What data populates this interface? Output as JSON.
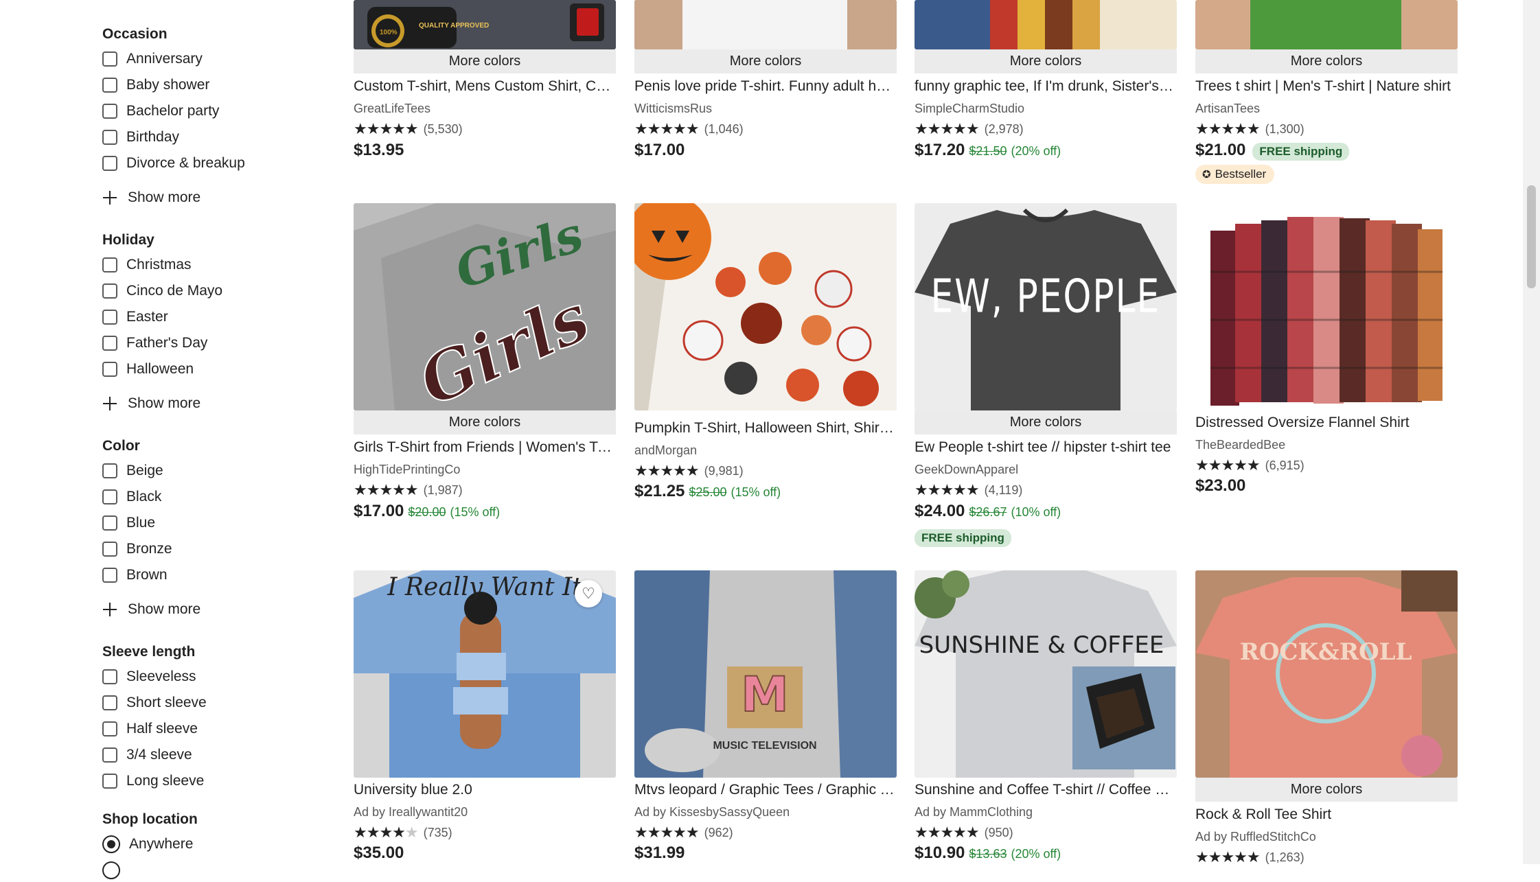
{
  "sidebar": {
    "occasion": {
      "title": "Occasion",
      "options": [
        "Anniversary",
        "Baby shower",
        "Bachelor party",
        "Birthday",
        "Divorce & breakup"
      ],
      "show_more": "Show more"
    },
    "holiday": {
      "title": "Holiday",
      "options": [
        "Christmas",
        "Cinco de Mayo",
        "Easter",
        "Father's Day",
        "Halloween"
      ],
      "show_more": "Show more"
    },
    "color": {
      "title": "Color",
      "options": [
        "Beige",
        "Black",
        "Blue",
        "Bronze",
        "Brown"
      ],
      "show_more": "Show more"
    },
    "sleeve_length": {
      "title": "Sleeve length",
      "options": [
        "Sleeveless",
        "Short sleeve",
        "Half sleeve",
        "3/4 sleeve",
        "Long sleeve"
      ]
    },
    "shop_location": {
      "title": "Shop location",
      "selected": "Anywhere"
    }
  },
  "listings": [
    {
      "more_colors": "More colors",
      "title": "Custom T-shirt, Mens Custom Shirt, Custom Printed T-shirt",
      "shop": "GreatLifeTees",
      "stars": "★★★★★",
      "count": "(5,530)",
      "price": "$13.95",
      "image_text": "QUALITY APPROVED"
    },
    {
      "more_colors": "More colors",
      "title": "Penis love pride T-shirt. Funny adult humor shirt",
      "shop": "WitticismsRus",
      "stars": "★★★★★",
      "count": "(1,046)",
      "price": "$17.00"
    },
    {
      "more_colors": "More colors",
      "title": "funny graphic tee, If I'm drunk, Sister's fault shirt",
      "shop": "SimpleCharmStudio",
      "stars": "★★★★★",
      "count": "(2,978)",
      "price": "$17.20",
      "original": "$21.50",
      "discount": "(20% off)"
    },
    {
      "more_colors": "More colors",
      "title": "Trees t shirt | Men's T-shirt | Nature shirt",
      "shop": "ArtisanTees",
      "stars": "★★★★★",
      "count": "(1,300)",
      "price": "$21.00",
      "free_shipping": "FREE shipping",
      "badge": "Bestseller"
    },
    {
      "more_colors": "More colors",
      "title": "Girls T-Shirt from Friends | Women's T-Shirt",
      "shop": "HighTidePrintingCo",
      "stars": "★★★★★",
      "count": "(1,987)",
      "price": "$17.00",
      "original": "$20.00",
      "discount": "(15% off)",
      "image_text": "Girls"
    },
    {
      "title": "Pumpkin T-Shirt, Halloween Shirt, Shirt for Fall",
      "shop": "andMorgan",
      "stars": "★★★★★",
      "count": "(9,981)",
      "price": "$21.25",
      "original": "$25.00",
      "discount": "(15% off)"
    },
    {
      "more_colors": "More colors",
      "title": "Ew People t-shirt tee // hipster t-shirt tee",
      "shop": "GeekDownApparel",
      "stars": "★★★★★",
      "count": "(4,119)",
      "price": "$24.00",
      "original": "$26.67",
      "discount": "(10% off)",
      "free_shipping": "FREE shipping",
      "image_text": "EW, PEOPLE"
    },
    {
      "title": "Distressed Oversize Flannel Shirt",
      "shop": "TheBeardedBee",
      "stars": "★★★★★",
      "count": "(6,915)",
      "price": "$23.00"
    },
    {
      "title": "University blue 2.0",
      "shop": "Ad by Ireallywantit20",
      "stars": "★★★★",
      "stars_dim": "★",
      "count": "(735)",
      "price": "$35.00",
      "image_text": "I Really Want It"
    },
    {
      "title": "Mtvs leopard / Graphic Tees / Graphic Tee Shirt",
      "shop": "Ad by KissesbySassyQueen",
      "stars": "★★★★★",
      "count": "(962)",
      "price": "$31.99",
      "image_text": "MUSIC TELEVISION"
    },
    {
      "title": "Sunshine and Coffee T-shirt // Coffee Lover Tee",
      "shop": "Ad by MammClothing",
      "stars": "★★★★★",
      "count": "(950)",
      "price": "$10.90",
      "original": "$13.63",
      "discount": "(20% off)",
      "image_text": "SUNSHINE & COFFEE"
    },
    {
      "more_colors": "More colors",
      "title": "Rock & Roll Tee Shirt",
      "shop": "Ad by RuffledStitchCo",
      "stars": "★★★★★",
      "count": "(1,263)",
      "image_text": "ROCK&ROLL"
    }
  ],
  "favorite_icon": "♡",
  "bestseller_icon": "✪"
}
